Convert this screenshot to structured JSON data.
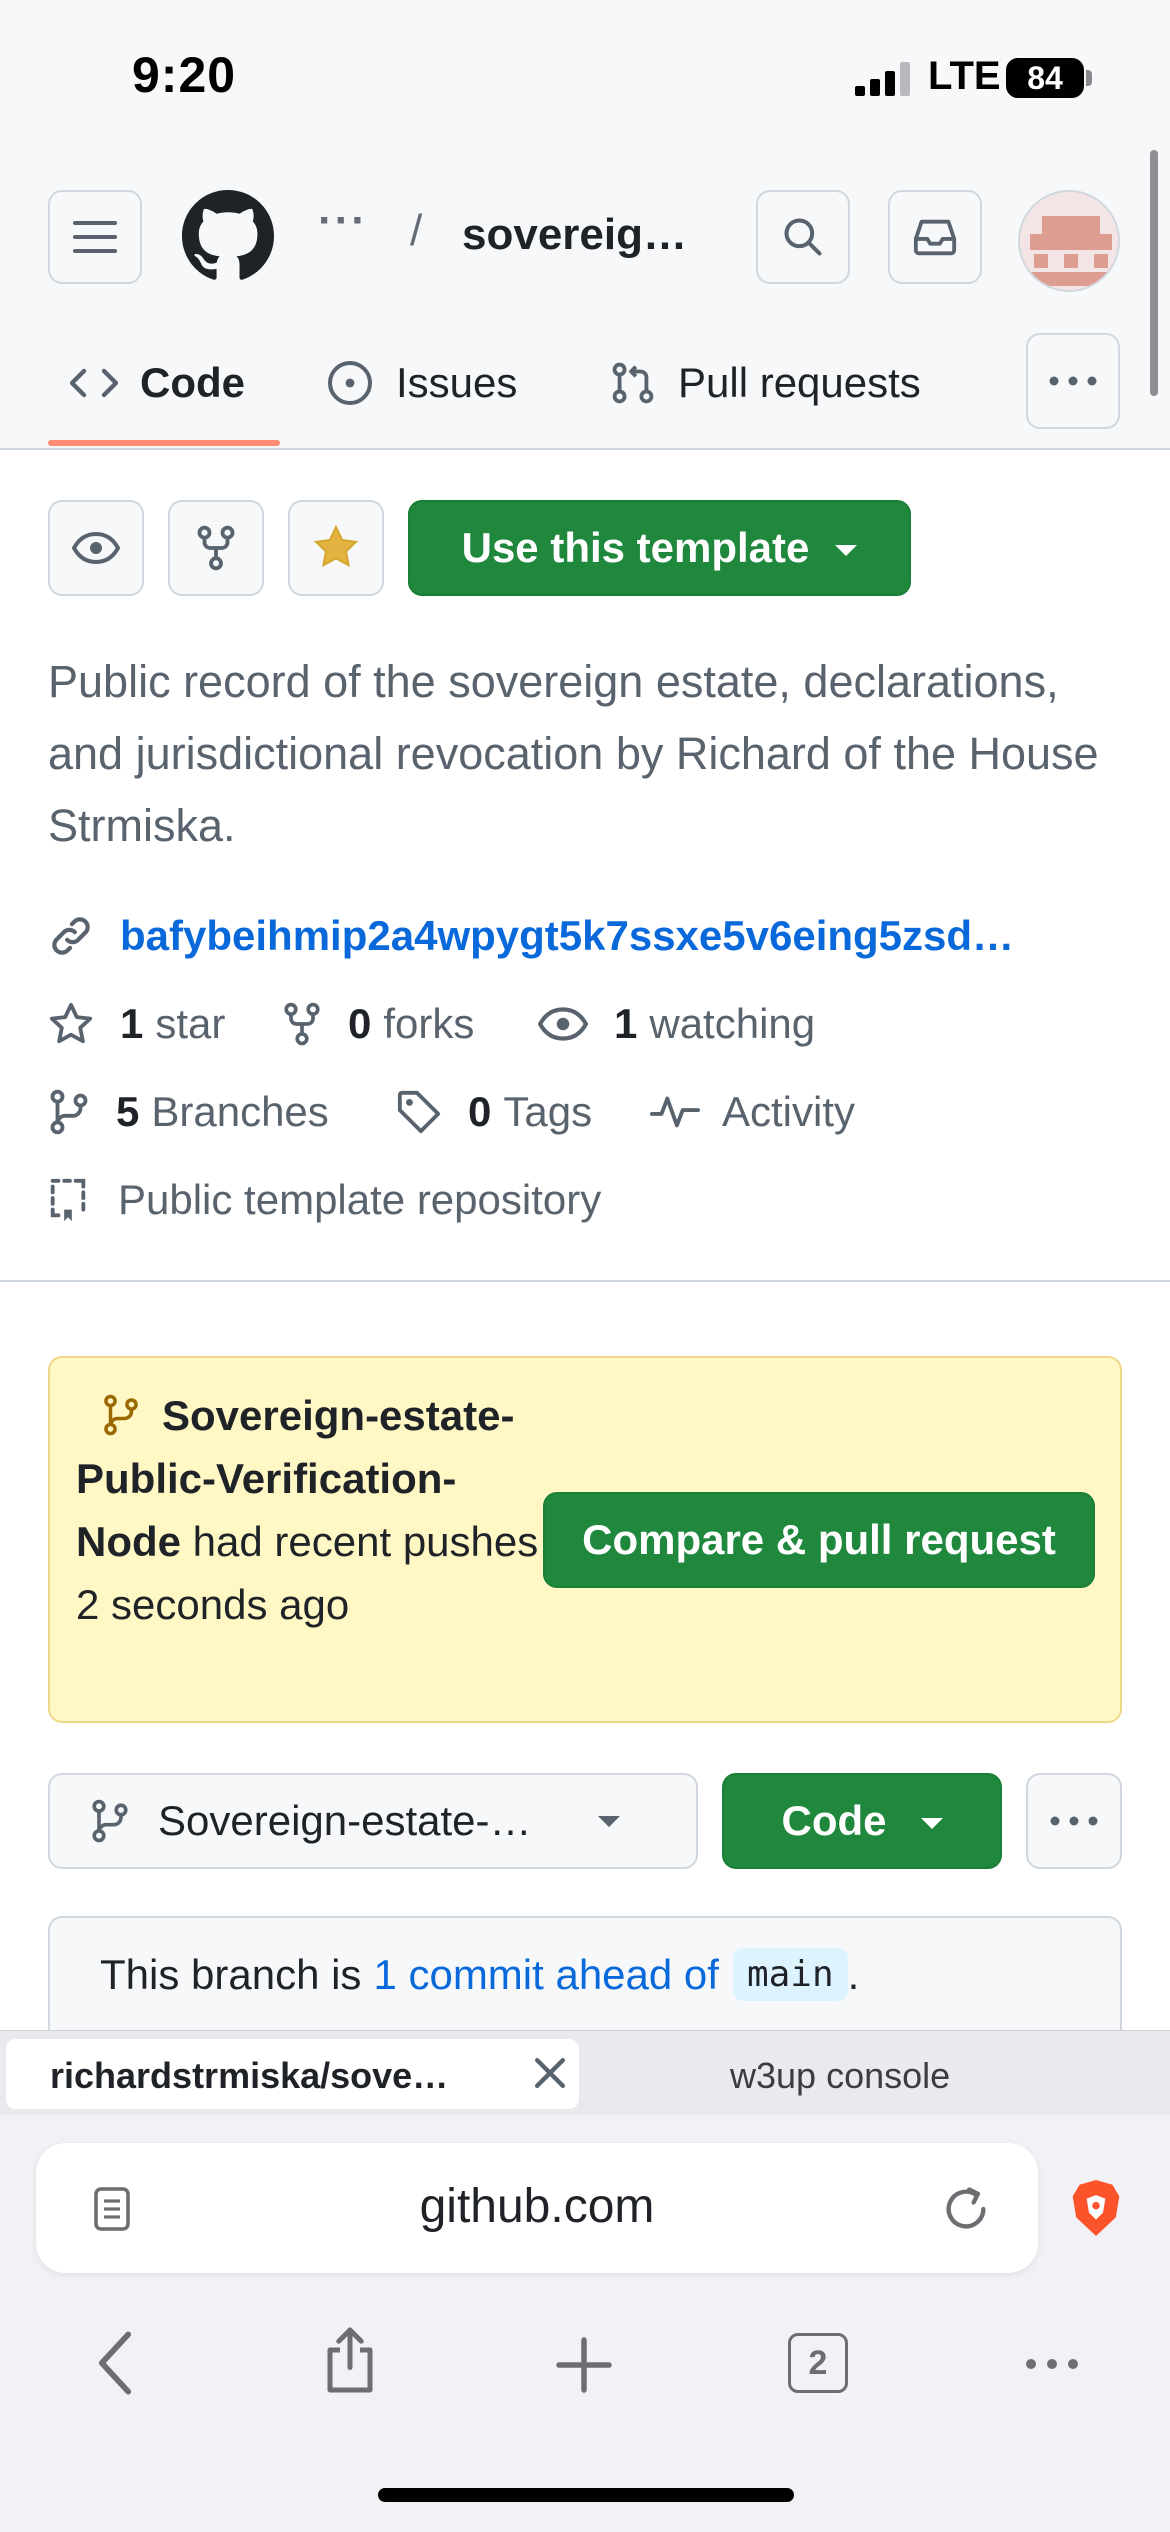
{
  "status_bar": {
    "time": "9:20",
    "network": "LTE",
    "battery": "84"
  },
  "header": {
    "breadcrumb_dots": "···",
    "breadcrumb_sep": "/",
    "repo_name": "sovereig…"
  },
  "tabs": [
    {
      "label": "Code",
      "icon": "code-icon"
    },
    {
      "label": "Issues",
      "icon": "issue-icon"
    },
    {
      "label": "Pull requests",
      "icon": "pull-request-icon"
    }
  ],
  "actions": {
    "template_button": "Use this template"
  },
  "description": "Public record of the sovereign estate, declarations, and jurisdictional revocation by Richard of the House Strmiska.",
  "website": "bafybeihmip2a4wpygt5k7ssxe5v6eing5zsd…",
  "stats": {
    "stars_count": "1",
    "stars_label": "star",
    "forks_count": "0",
    "forks_label": "forks",
    "watching_count": "1",
    "watching_label": "watching",
    "branches_count": "5",
    "branches_label": "Branches",
    "tags_count": "0",
    "tags_label": "Tags",
    "activity_label": "Activity",
    "template_label": "Public template repository"
  },
  "flash": {
    "branch": "Sovereign-estate-Public-Verification-Node",
    "message": "had recent pushes 2 seconds ago",
    "button": "Compare & pull request"
  },
  "branch_bar": {
    "selected_branch": "Sovereign-estate-…",
    "code_button": "Code"
  },
  "branch_status": {
    "prefix": "This branch is",
    "link": "1 commit ahead of",
    "base": "main",
    "suffix": "."
  },
  "browser": {
    "active_tab": "richardstrmiska/sove…",
    "inactive_tab": "w3up console",
    "url": "github.com",
    "tab_count": "2"
  },
  "colors": {
    "primary_green": "#1f883d",
    "link_blue": "#0969da",
    "tab_accent": "#fd8c73",
    "flash_bg": "#fff8c5"
  }
}
